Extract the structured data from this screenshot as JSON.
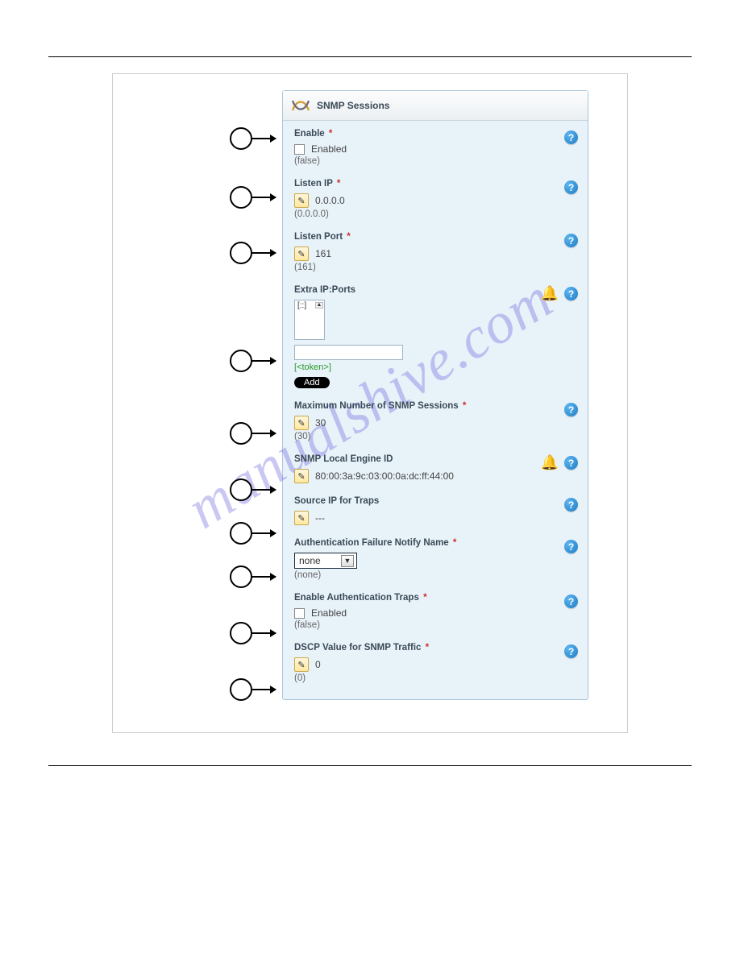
{
  "panel": {
    "title": "SNMP Sessions"
  },
  "fields": {
    "enable": {
      "label": "Enable",
      "required": "*",
      "option": "Enabled",
      "default": "(false)"
    },
    "listen_ip": {
      "label": "Listen IP",
      "required": "*",
      "value": "0.0.0.0",
      "default": "(0.0.0.0)"
    },
    "listen_port": {
      "label": "Listen Port",
      "required": "*",
      "value": "161",
      "default": "(161)"
    },
    "extra": {
      "label": "Extra IP:Ports",
      "list_value": "[::]",
      "token": "[<token>]",
      "add": "Add"
    },
    "max_sessions": {
      "label": "Maximum Number of SNMP Sessions",
      "required": "*",
      "value": "30",
      "default": "(30)"
    },
    "engine_id": {
      "label": "SNMP Local Engine ID",
      "value": "80:00:3a:9c:03:00:0a:dc:ff:44:00"
    },
    "source_ip": {
      "label": "Source IP for Traps",
      "value": "---"
    },
    "auth_notify": {
      "label": "Authentication Failure Notify Name",
      "required": "*",
      "value": "none",
      "default": "(none)"
    },
    "auth_traps": {
      "label": "Enable Authentication Traps",
      "required": "*",
      "option": "Enabled",
      "default": "(false)"
    },
    "dscp": {
      "label": "DSCP Value for SNMP Traffic",
      "required": "*",
      "value": "0",
      "default": "(0)"
    }
  },
  "ui": {
    "help": "?",
    "pencil": "✎",
    "bell": "🔔",
    "dropdown": "▼"
  },
  "watermark": "manualshive.com"
}
